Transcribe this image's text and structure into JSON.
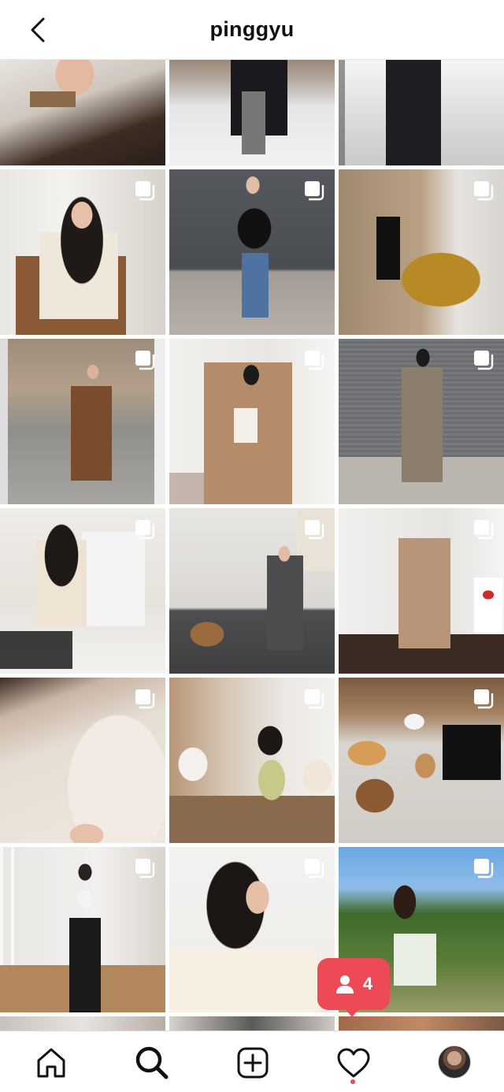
{
  "header": {
    "title": "pinggyu"
  },
  "notification": {
    "count": "4",
    "icon": "person-icon",
    "color": "#ed4956"
  },
  "tabbar": {
    "items": [
      "home-icon",
      "search-icon",
      "new-post-icon",
      "activity-heart-icon",
      "profile-avatar"
    ],
    "active": "search-icon"
  }
}
